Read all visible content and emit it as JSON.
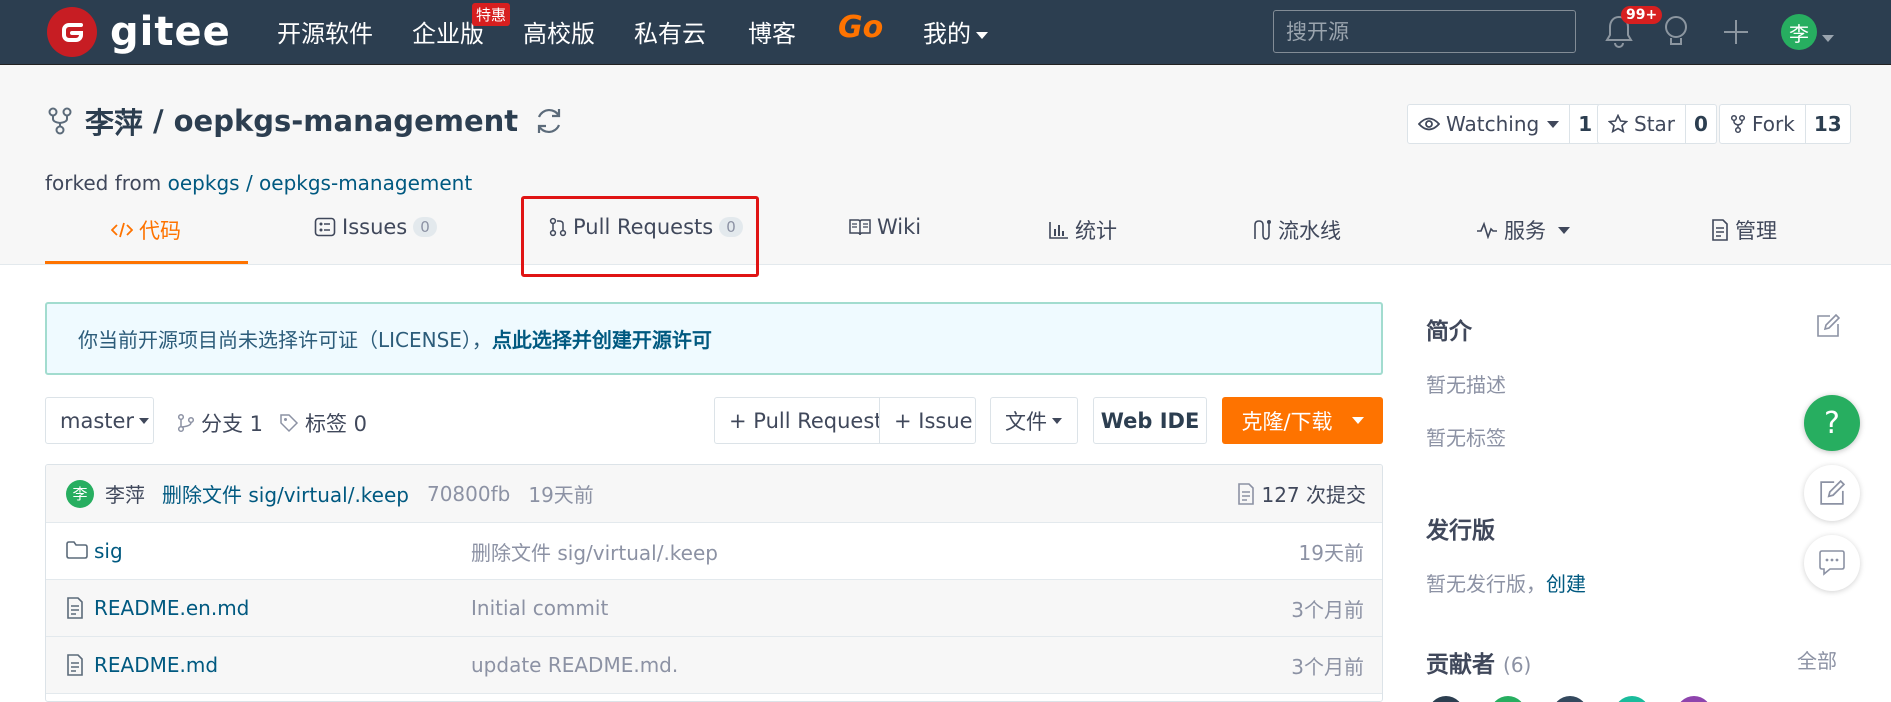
{
  "topbar": {
    "logo_text": "gitee",
    "nav": [
      "开源软件",
      "企业版",
      "高校版",
      "私有云",
      "博客",
      "Go",
      "我的"
    ],
    "hot_tag": "特惠",
    "search_placeholder": "搜开源",
    "notification_count": "99+",
    "avatar_letter": "李"
  },
  "repo": {
    "owner": "李萍",
    "separator": "/",
    "name": "oepkgs-management",
    "forked_prefix": "forked from",
    "forked_owner": "oepkgs",
    "forked_sep": "/",
    "forked_repo": "oepkgs-management",
    "watch_label": "Watching",
    "watch_count": "1",
    "star_label": "Star",
    "star_count": "0",
    "fork_label": "Fork",
    "fork_count": "13"
  },
  "tabs": [
    {
      "label": "代码"
    },
    {
      "label": "Issues",
      "count": "0"
    },
    {
      "label": "Pull Requests",
      "count": "0"
    },
    {
      "label": "Wiki"
    },
    {
      "label": "统计"
    },
    {
      "label": "流水线"
    },
    {
      "label": "服务"
    },
    {
      "label": "管理"
    }
  ],
  "license_banner": {
    "text": "你当前开源项目尚未选择许可证（LICENSE），",
    "link": "点此选择并创建开源许可"
  },
  "toolbar": {
    "branch": "master",
    "branches_label": "分支 1",
    "tags_label": "标签 0",
    "new_pr": "+ Pull Request",
    "new_issue": "+ Issue",
    "file_menu": "文件",
    "web_ide": "Web IDE",
    "clone": "克隆/下载"
  },
  "latest_commit": {
    "avatar_letter": "李",
    "author": "李萍",
    "message": "删除文件 sig/virtual/.keep",
    "sha": "70800fb",
    "time": "19天前",
    "commit_count": "127 次提交"
  },
  "files": [
    {
      "type": "folder",
      "name": "sig",
      "message": "删除文件 sig/virtual/.keep",
      "time": "19天前"
    },
    {
      "type": "file",
      "name": "README.en.md",
      "message": "Initial commit",
      "time": "3个月前"
    },
    {
      "type": "file",
      "name": "README.md",
      "message": "update README.md.",
      "time": "3个月前"
    }
  ],
  "sidebar": {
    "intro_title": "简介",
    "no_desc": "暂无描述",
    "no_tags": "暂无标签",
    "release_title": "发行版",
    "no_release": "暂无发行版，",
    "create_link": "创建",
    "contrib_title": "贡献者",
    "contrib_count": "(6)",
    "contrib_all": "全部"
  },
  "colors": {
    "topbar_bg": "#2c3e50",
    "accent_orange": "#fe7300",
    "link_blue": "#005980",
    "green": "#27ae60",
    "highlight_red": "#e01414"
  }
}
